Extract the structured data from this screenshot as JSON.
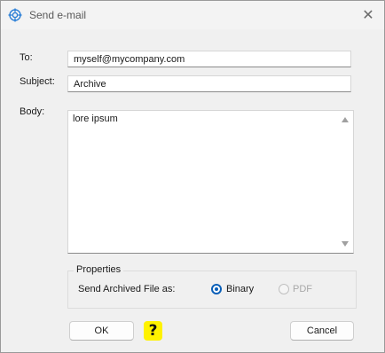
{
  "window": {
    "title": "Send e-mail",
    "close_glyph": "✕"
  },
  "form": {
    "to_label": "To:",
    "to_value": "myself@mycompany.com",
    "subject_label": "Subject:",
    "subject_value": "Archive",
    "body_label": "Body:",
    "body_value": "lore ipsum"
  },
  "properties": {
    "legend": "Properties",
    "send_label": "Send Archived File as:",
    "options": [
      {
        "label": "Binary",
        "selected": true,
        "enabled": true
      },
      {
        "label": "PDF",
        "selected": false,
        "enabled": false
      }
    ]
  },
  "buttons": {
    "ok": "OK",
    "help": "?",
    "cancel": "Cancel"
  },
  "colors": {
    "accent": "#0a5fb8",
    "help_bg": "#fff200"
  }
}
